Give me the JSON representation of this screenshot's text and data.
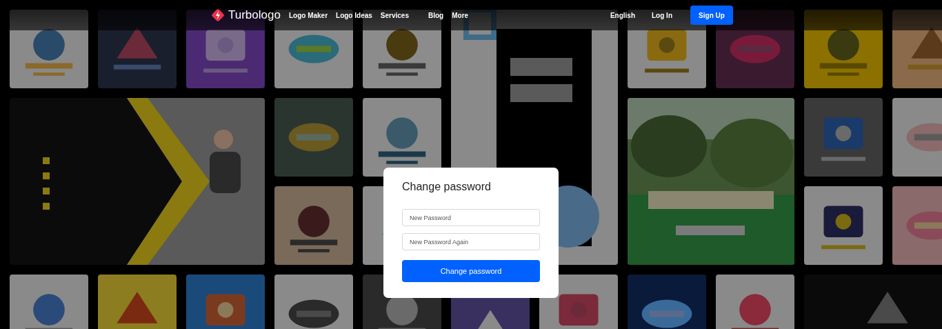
{
  "header": {
    "brand": "Turbologo",
    "nav": [
      "Logo Maker",
      "Logo Ideas",
      "Services",
      "Blog",
      "More"
    ],
    "language": "English",
    "login": "Log In",
    "signup": "Sign Up"
  },
  "dialog": {
    "title": "Change password",
    "fields": [
      {
        "placeholder": "New Password"
      },
      {
        "placeholder": "New Password Again"
      }
    ],
    "submit": "Change password"
  }
}
